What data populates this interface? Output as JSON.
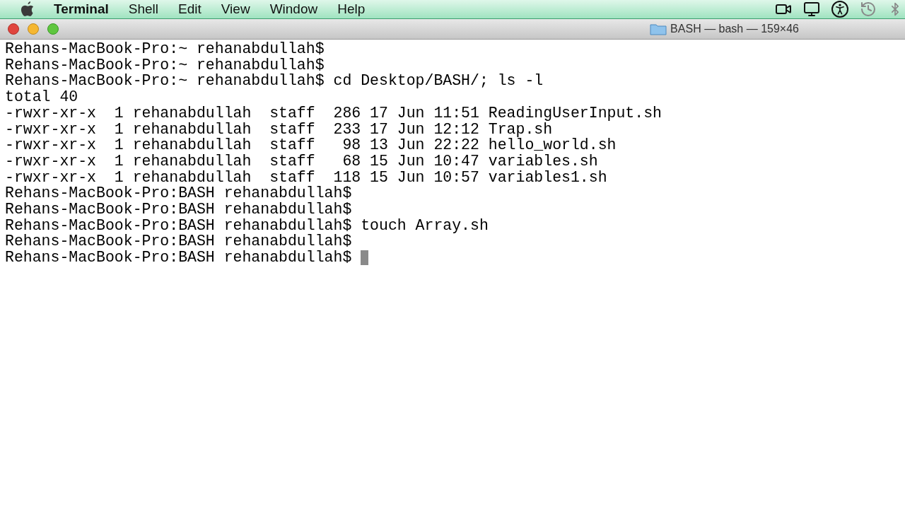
{
  "menu_bar": {
    "app_name": "Terminal",
    "items": [
      "Shell",
      "Edit",
      "View",
      "Window",
      "Help"
    ]
  },
  "window": {
    "title": "BASH — bash — 159×46"
  },
  "terminal": {
    "lines": [
      "Rehans-MacBook-Pro:~ rehanabdullah$",
      "Rehans-MacBook-Pro:~ rehanabdullah$",
      "Rehans-MacBook-Pro:~ rehanabdullah$ cd Desktop/BASH/; ls -l",
      "total 40",
      "-rwxr-xr-x  1 rehanabdullah  staff  286 17 Jun 11:51 ReadingUserInput.sh",
      "-rwxr-xr-x  1 rehanabdullah  staff  233 17 Jun 12:12 Trap.sh",
      "-rwxr-xr-x  1 rehanabdullah  staff   98 13 Jun 22:22 hello_world.sh",
      "-rwxr-xr-x  1 rehanabdullah  staff   68 15 Jun 10:47 variables.sh",
      "-rwxr-xr-x  1 rehanabdullah  staff  118 15 Jun 10:57 variables1.sh",
      "Rehans-MacBook-Pro:BASH rehanabdullah$",
      "Rehans-MacBook-Pro:BASH rehanabdullah$",
      "Rehans-MacBook-Pro:BASH rehanabdullah$ touch Array.sh",
      "Rehans-MacBook-Pro:BASH rehanabdullah$",
      "Rehans-MacBook-Pro:BASH rehanabdullah$"
    ]
  }
}
